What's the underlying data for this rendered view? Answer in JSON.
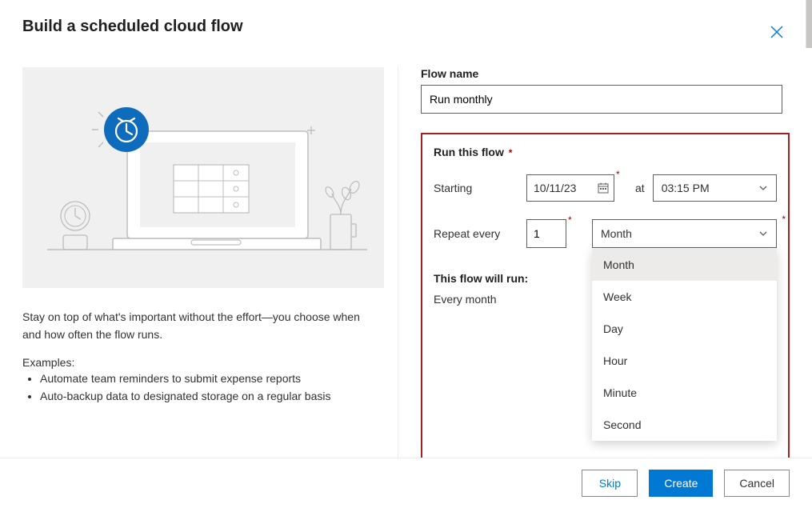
{
  "title": "Build a scheduled cloud flow",
  "description": "Stay on top of what's important without the effort—you choose when and how often the flow runs.",
  "examples_label": "Examples:",
  "examples": [
    "Automate team reminders to submit expense reports",
    "Auto-backup data to designated storage on a regular basis"
  ],
  "form": {
    "flow_name_label": "Flow name",
    "flow_name_value": "Run monthly",
    "section_label": "Run this flow",
    "starting_label": "Starting",
    "starting_date": "10/11/23",
    "at_label": "at",
    "starting_time": "03:15 PM",
    "repeat_label": "Repeat every",
    "repeat_count": "1",
    "repeat_unit": "Month",
    "unit_options": [
      "Month",
      "Week",
      "Day",
      "Hour",
      "Minute",
      "Second"
    ],
    "run_summary_label": "This flow will run:",
    "run_summary_text": "Every month"
  },
  "buttons": {
    "skip": "Skip",
    "create": "Create",
    "cancel": "Cancel"
  }
}
